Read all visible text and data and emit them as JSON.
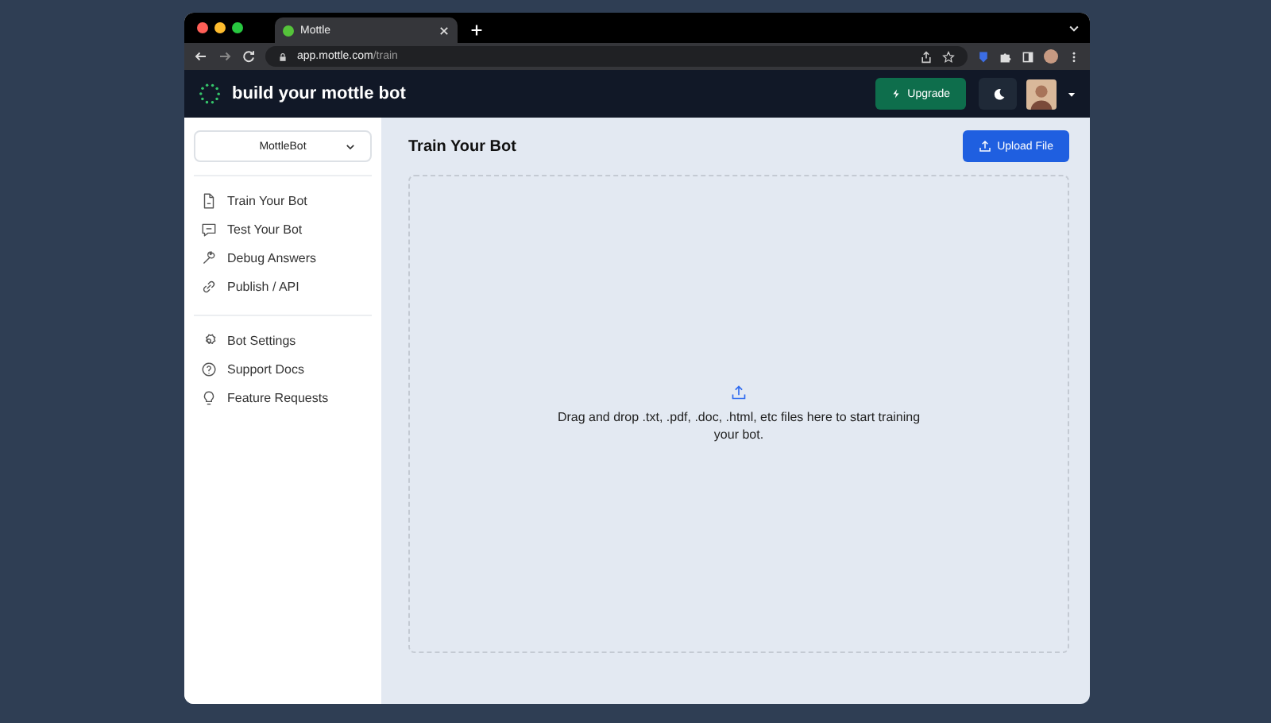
{
  "browser": {
    "tab_title": "Mottle",
    "url_host": "app.mottle.com",
    "url_path": "/train"
  },
  "header": {
    "title": "build your mottle bot",
    "upgrade_button": "Upgrade"
  },
  "sidebar": {
    "bot_select": "MottleBot",
    "groups": [
      [
        {
          "label": "Train Your Bot",
          "selected": false
        },
        {
          "label": "Test Your Bot",
          "selected": false
        },
        {
          "label": "Debug Answers",
          "selected": false
        },
        {
          "label": "Publish / API",
          "selected": false
        }
      ],
      [
        {
          "label": "Bot Settings",
          "selected": false
        },
        {
          "label": "Support Docs",
          "selected": false
        },
        {
          "label": "Feature Requests",
          "selected": false
        }
      ]
    ]
  },
  "main": {
    "title": "Train Your Bot",
    "upload_button": "Upload File",
    "dropzone_text": "Drag and drop .txt, .pdf, .doc, .html, etc files here to start training your bot."
  }
}
